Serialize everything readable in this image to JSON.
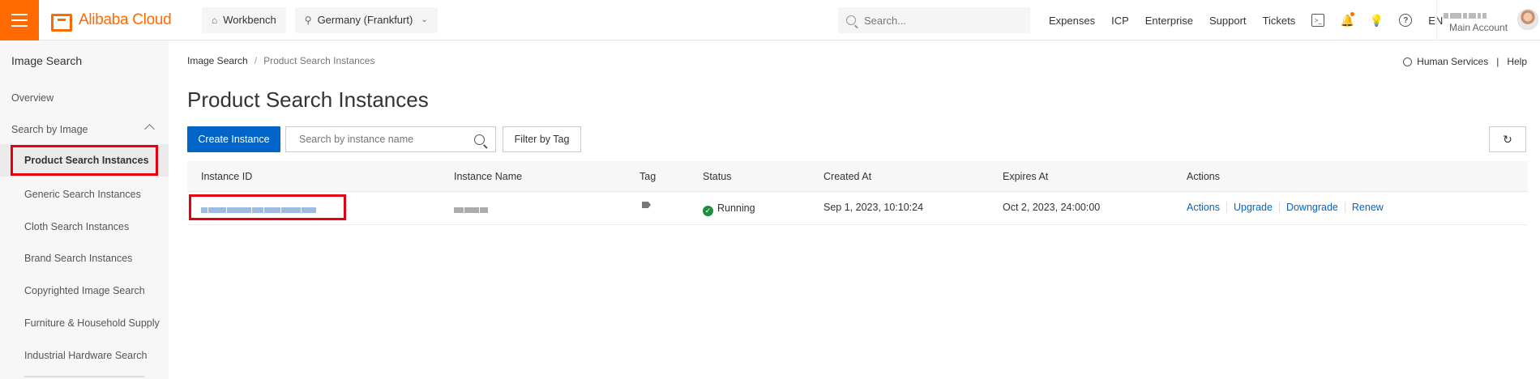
{
  "topbar": {
    "brand": "Alibaba Cloud",
    "workbench": "Workbench",
    "region": "Germany (Frankfurt)",
    "search_placeholder": "Search...",
    "nav": [
      "Expenses",
      "ICP",
      "Enterprise",
      "Support",
      "Tickets"
    ],
    "language": "EN",
    "account_subtitle": "Main Account",
    "accent_color": "#ff6a00"
  },
  "sidebar": {
    "title": "Image Search",
    "overview": "Overview",
    "group_label": "Search by Image",
    "active_item": "Product Search Instances",
    "sub_items": [
      "Generic Search Instances",
      "Cloth Search Instances",
      "Brand Search Instances",
      "Copyrighted Image Search",
      "Furniture & Household Supply",
      "Industrial Hardware Search"
    ]
  },
  "main": {
    "breadcrumb": [
      "Image Search",
      "Product Search Instances"
    ],
    "human_services": "Human Services",
    "help": "Help",
    "title": "Product Search Instances",
    "create_button": "Create Instance",
    "search_placeholder": "Search by instance name",
    "filter_button": "Filter by Tag",
    "columns": [
      "Instance ID",
      "Instance Name",
      "Tag",
      "Status",
      "Created At",
      "Expires At",
      "Actions"
    ],
    "rows": [
      {
        "status": "Running",
        "created_at": "Sep 1, 2023, 10:10:24",
        "expires_at": "Oct 2, 2023, 24:00:00",
        "actions": [
          "Actions",
          "Upgrade",
          "Downgrade",
          "Renew"
        ]
      }
    ],
    "primary_color": "#0064c8",
    "status_color": "#1e8e3e",
    "highlight_color": "#e60012"
  }
}
